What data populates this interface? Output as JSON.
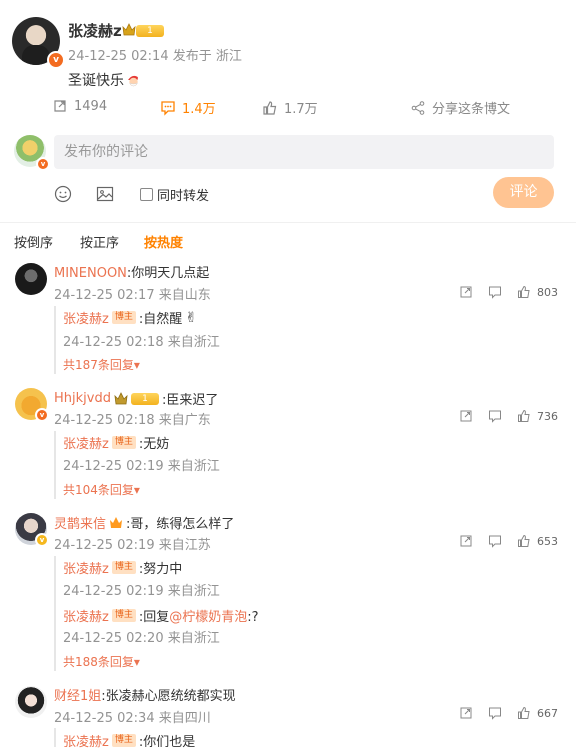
{
  "post": {
    "author": "张凌赫z",
    "level": "1",
    "time_location": "24-12-25 02:14 发布于 浙江",
    "content": "圣诞快乐",
    "repost_count": "1494",
    "comment_count": "1.4万",
    "like_count": "1.7万",
    "share_label": "分享这条博文"
  },
  "composer": {
    "placeholder": "发布你的评论",
    "repost_label": "同时转发",
    "submit_label": "评论"
  },
  "sort": [
    "按倒序",
    "按正序",
    "按热度"
  ],
  "comments": [
    {
      "user": "MINENOON",
      "text": ":你明天几点起",
      "time": "24-12-25 02:17",
      "location": "来自山东",
      "likes": "803",
      "reply": {
        "user": "张凌赫z",
        "tag": "博主",
        "text": ":自然醒",
        "time": "24-12-25 02:18",
        "location": "来自浙江"
      },
      "more": "共187条回复"
    },
    {
      "user": "Hhjkjvdd",
      "text": ":臣来迟了",
      "time": "24-12-25 02:18",
      "location": "来自广东",
      "likes": "736",
      "reply": {
        "user": "张凌赫z",
        "tag": "博主",
        "text": ":无妨",
        "time": "24-12-25 02:19",
        "location": "来自浙江"
      },
      "more": "共104条回复"
    },
    {
      "user": "灵鹊来信",
      "text": ":哥，练得怎么样了",
      "time": "24-12-25 02:19",
      "location": "来自江苏",
      "likes": "653",
      "reply": {
        "user": "张凌赫z",
        "tag": "博主",
        "text": ":努力中",
        "time": "24-12-25 02:19",
        "location": "来自浙江"
      },
      "reply2": {
        "user": "张凌赫z",
        "tag": "博主",
        "prefix": ":回复",
        "mention": "@柠檬奶青泡",
        "suffix": ":?",
        "time": "24-12-25 02:20",
        "location": "来自浙江"
      },
      "more": "共188条回复"
    },
    {
      "user": "财经1姐",
      "text": ":张凌赫心愿统统都实现",
      "time": "24-12-25 02:34",
      "location": "来自四川",
      "likes": "667",
      "reply": {
        "user": "张凌赫z",
        "tag": "博主",
        "text": ":你们也是"
      }
    }
  ],
  "colors": {
    "accent": "#ff8200",
    "username": "#eb7350",
    "submit_bg": "#ffc492",
    "input_bg": "#f2f2f4"
  },
  "icons": [
    "repost-icon",
    "comment-icon",
    "like-icon",
    "share-icon",
    "emoji-icon",
    "image-icon",
    "checkbox-icon",
    "crown-icon",
    "vip-badge-icon",
    "santa-emoji-icon",
    "victory-hand-emoji-icon"
  ]
}
